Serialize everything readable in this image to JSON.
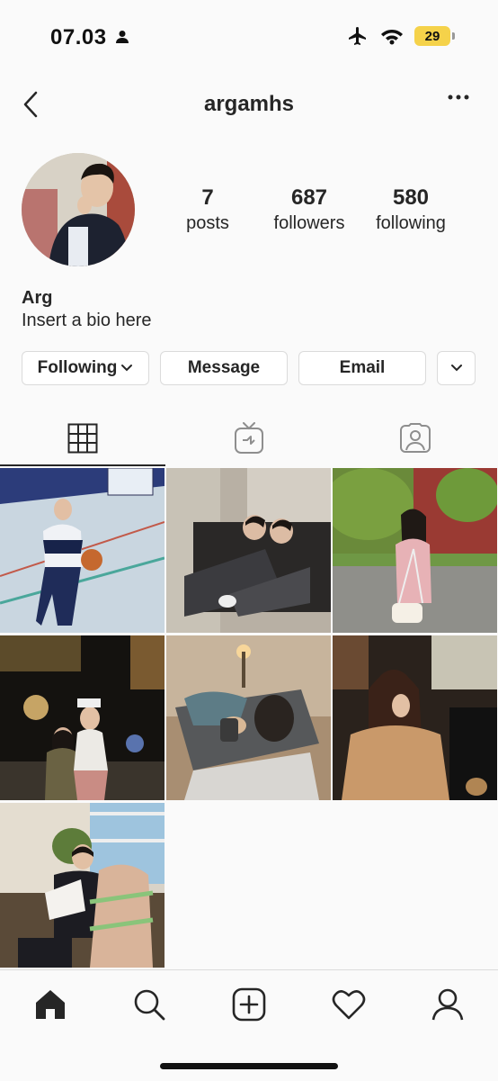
{
  "status": {
    "time": "07.03",
    "battery": "29"
  },
  "header": {
    "username": "argamhs"
  },
  "profile": {
    "name": "Arg",
    "bio": "Insert a bio here",
    "stats": [
      {
        "value": "7",
        "label": "posts"
      },
      {
        "value": "687",
        "label": "followers"
      },
      {
        "value": "580",
        "label": "following"
      }
    ]
  },
  "actions": {
    "following": "Following",
    "message": "Message",
    "email": "Email"
  },
  "tabs": [
    "grid-icon",
    "igtv-icon",
    "tagged-icon"
  ],
  "bottom_nav": [
    "home-icon",
    "search-icon",
    "new-post-icon",
    "activity-icon",
    "profile-icon"
  ]
}
